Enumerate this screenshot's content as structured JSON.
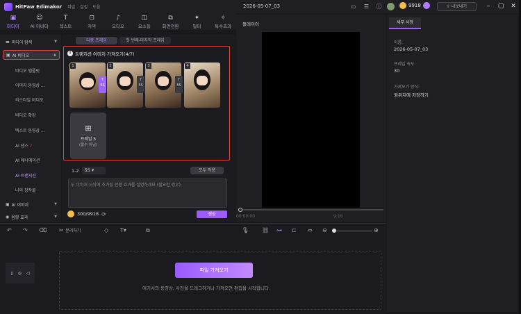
{
  "app": {
    "name": "HitPaw Edimakor",
    "doc_title": "2026-05-07_03"
  },
  "menus": [
    "파일",
    "설정",
    "도움"
  ],
  "account": {
    "coins": "9918",
    "export_label": "내보내기"
  },
  "toolbar": [
    {
      "label": "미디어",
      "icon": "media-icon"
    },
    {
      "label": "AI 아바타",
      "icon": "avatar-icon"
    },
    {
      "label": "텍스트",
      "icon": "text-icon"
    },
    {
      "label": "자막",
      "icon": "caption-icon"
    },
    {
      "label": "오디오",
      "icon": "audio-icon"
    },
    {
      "label": "요소들",
      "icon": "elements-icon"
    },
    {
      "label": "화면전환",
      "icon": "transition-icon"
    },
    {
      "label": "필터",
      "icon": "filter-icon"
    },
    {
      "label": "특수효과",
      "icon": "effects-icon"
    }
  ],
  "nav": {
    "media_explorer": "미디어 탐색",
    "ai_video": "AI 비디오",
    "sub_items": [
      "비디오 템플릿",
      "이미지 동영상 ...",
      "리스타일 비디오",
      "비디오 확장",
      "텍스트 동영상 ...",
      "AI 댄스",
      "AI 애니메이션",
      "AI 트랜지션",
      "나의 창작물"
    ],
    "ai_image": "AI 이미지",
    "sound": "음향 효과"
  },
  "media": {
    "tab_left": "다중 프레임",
    "tab_right": "첫 번째-마지막 프레임",
    "hint": "트랜지션 이미지 가져오기(4/7)",
    "frames": [
      "1",
      "2",
      "3",
      "4"
    ],
    "transitions": [
      {
        "badge": "T",
        "dur": "5S",
        "selected": true
      },
      {
        "badge": "T",
        "dur": "5S",
        "selected": false
      },
      {
        "badge": "T",
        "dur": "5S",
        "selected": false
      }
    ],
    "add_frame_title": "프레임 5",
    "add_frame_sub": "(필수 아님)",
    "ratio_prefix": "1-2",
    "ratio_value": "5S",
    "apply_all": "모두 적용",
    "prompt_placeholder": "두 이미지 사이에 추가될 전환 효과를 설명하세요 (필요한 경우).",
    "cost": "300/9918",
    "generate": "생성"
  },
  "player": {
    "title": "플레이어",
    "timecode": "00:00:00",
    "duration": "9:16"
  },
  "details": {
    "tab": "세부 사항",
    "name_label": "이름:",
    "name_value": "2026-05-07_03",
    "fps_label": "프레임 속도:",
    "fps_value": "30",
    "import_label": "가져오기 방식:",
    "import_value": "원위치에 저장하기"
  },
  "timeline": {
    "split_label": "분리하기",
    "import_button": "파일 가져오기",
    "drop_hint": "여기서의 동영상, 사진을 드래그하거나 가져오면 편집을 시작합니다."
  }
}
